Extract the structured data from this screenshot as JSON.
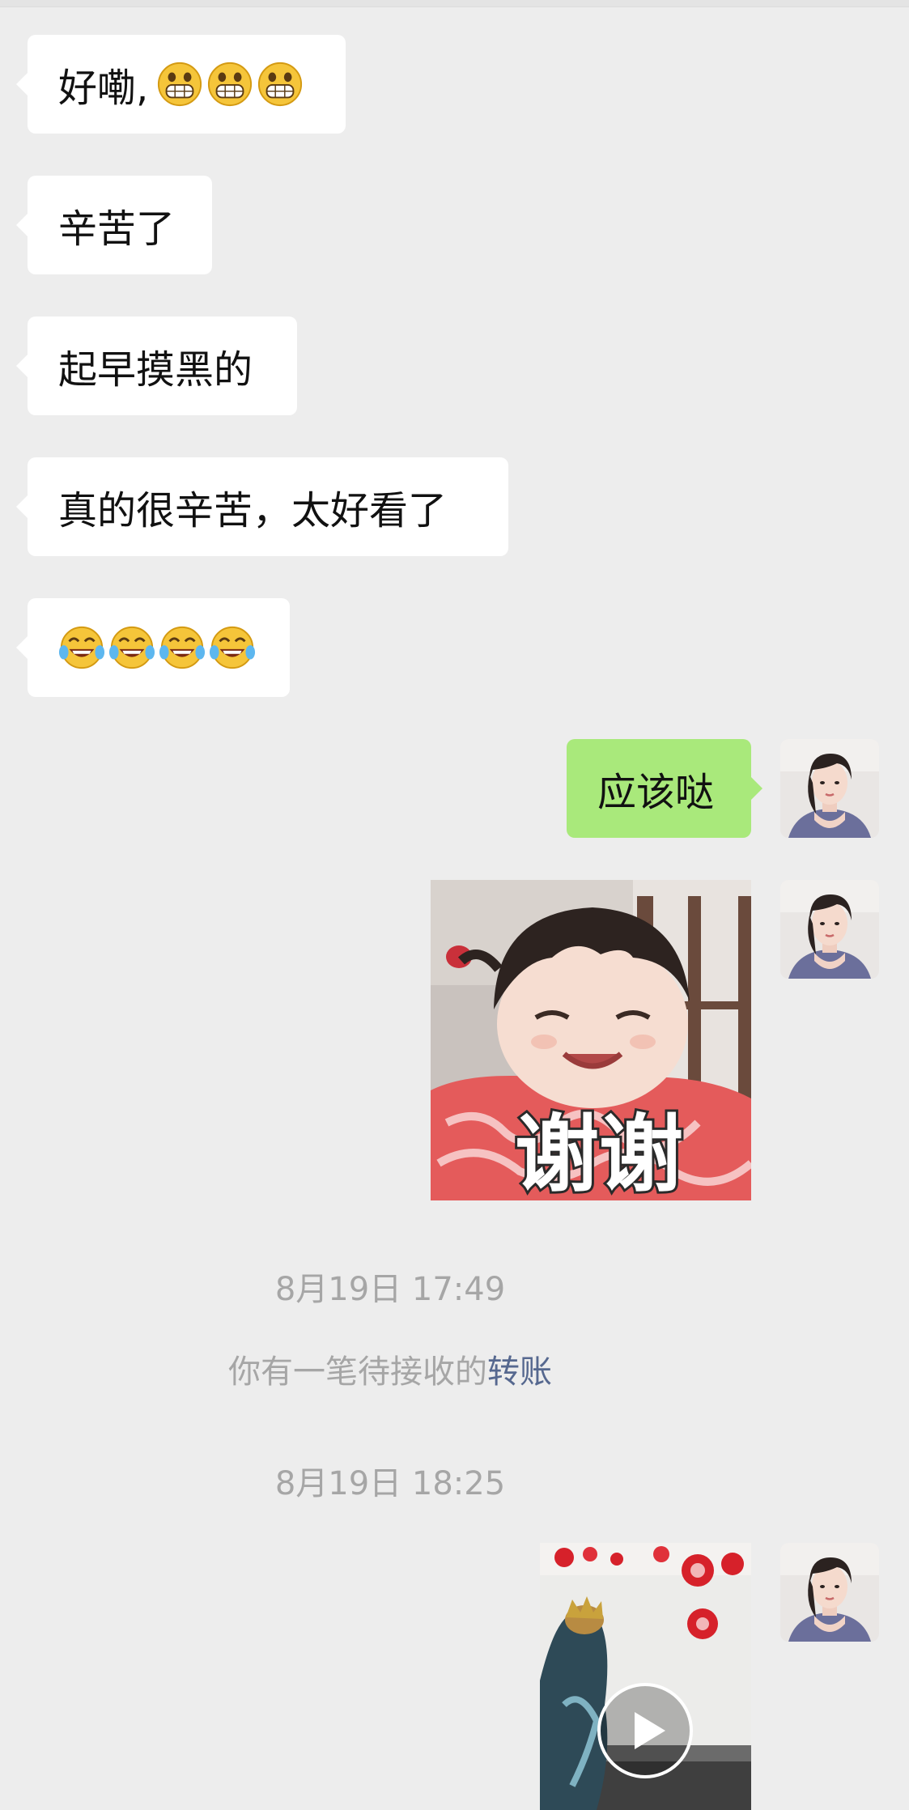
{
  "messages": {
    "m1_text": "好嘞,",
    "m1_emojis": [
      "grinning-face-icon",
      "grinning-face-icon",
      "grinning-face-icon"
    ],
    "m2_text": "辛苦了",
    "m3_text": "起早摸黑的",
    "m4_text": "真的很辛苦，太好看了",
    "m5_emojis": [
      "tears-of-joy-icon",
      "tears-of-joy-icon",
      "tears-of-joy-icon",
      "tears-of-joy-icon"
    ],
    "m6_text": "应该哒",
    "sticker_caption": "谢谢"
  },
  "timestamps": {
    "t1": "8月19日 17:49",
    "t2": "8月19日 18:25"
  },
  "system": {
    "transfer_prefix": "你有一笔待接收的",
    "transfer_link": "转账"
  },
  "colors": {
    "background": "#ededed",
    "incoming_bubble": "#ffffff",
    "outgoing_bubble": "#a9e97b",
    "timestamp_text": "#a6a6a6",
    "link_text": "#56688f"
  },
  "icons": {
    "video_play": "play-icon",
    "avatar": "user-avatar"
  }
}
